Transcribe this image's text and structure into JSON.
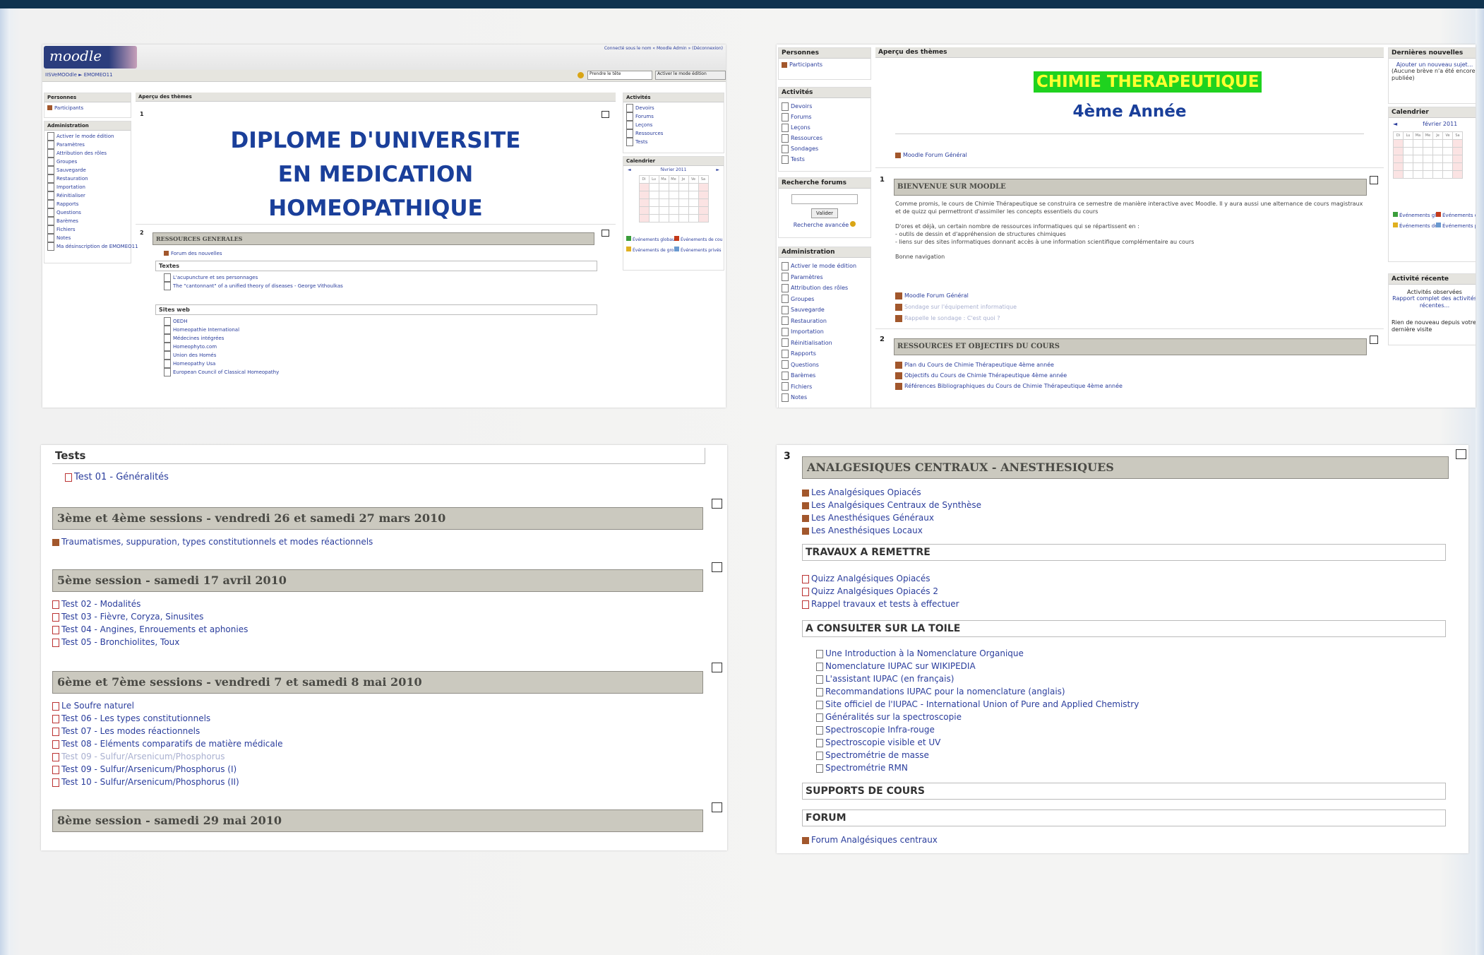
{
  "p1": {
    "logo": "moodle",
    "breadcrumb": "IISVeMOOdle ► EMOMEO11",
    "top_links": "Connecté sous le nom « Moodle Admin » (Déconnexion)",
    "jump_select": "Prendre le tête",
    "edit_button": "Activer le mode édition",
    "left_blocks": {
      "people_title": "Personnes",
      "participants": "Participants",
      "admin_title": "Administration",
      "admin_items": [
        "Activer le mode édition",
        "Paramètres",
        "Attribution des rôles",
        "Groupes",
        "Sauvegarde",
        "Restauration",
        "Importation",
        "Réinitialiser",
        "Rapports",
        "Questions",
        "Barèmes",
        "Fichiers",
        "Notes",
        "Ma désinscription de EMOMEO11"
      ]
    },
    "main": {
      "header": "Aperçu des thèmes",
      "sec1_num": "1",
      "title_line1": "DIPLOME D'UNIVERSITE",
      "title_line2": "EN MEDICATION",
      "title_line3": "HOMEOPATHIQUE",
      "sec2_num": "2",
      "res_title": "RESSOURCES GENERALES",
      "forum": "Forum des nouvelles",
      "textes_title": "Textes",
      "textes": [
        "L'acupuncture et ses personnages",
        "The \"cantonnant\" of a unified theory of diseases - George Vithoulkas"
      ],
      "sites_title": "Sites web",
      "sites": [
        "OEDH",
        "Homeopathie International",
        "Médecines intégrées",
        "Homeophyto.com",
        "Union des Homés",
        "Homeopathy Usa",
        "European Council of Classical Homeopathy"
      ]
    },
    "right_blocks": {
      "activities_title": "Activités",
      "activities": [
        "Devoirs",
        "Forums",
        "Leçons",
        "Ressources",
        "Tests"
      ],
      "calendar_title": "Calendrier",
      "calendar_month": "février 2011",
      "calendar_days": [
        "Di",
        "Lu",
        "Ma",
        "Me",
        "Je",
        "Ve",
        "Sa"
      ],
      "legend": [
        "Événements globaux",
        "Événements de cours",
        "Événements de groupe",
        "Événements privés"
      ]
    }
  },
  "p2": {
    "left_blocks": {
      "people_title": "Personnes",
      "participants": "Participants",
      "activities_title": "Activités",
      "activities": [
        "Devoirs",
        "Forums",
        "Leçons",
        "Ressources",
        "Sondages",
        "Tests"
      ],
      "search_title": "Recherche forums",
      "search_button": "Valider",
      "search_adv": "Recherche avancée",
      "admin_title": "Administration",
      "admin_items": [
        "Activer le mode édition",
        "Paramètres",
        "Attribution des rôles",
        "Groupes",
        "Sauvegarde",
        "Restauration",
        "Importation",
        "Réinitialisation",
        "Rapports",
        "Questions",
        "Barèmes",
        "Fichiers",
        "Notes"
      ]
    },
    "main": {
      "header": "Aperçu des thèmes",
      "title_green": "CHIMIE THERAPEUTIQUE",
      "subtitle": "4ème Année",
      "forum_general": "Moodle Forum Général",
      "sec1_num": "1",
      "welcome_title": "BIENVENUE SUR MOODLE",
      "welcome_p1": "Comme promis, le cours de Chimie Thérapeutique se construira ce semestre de manière interactive avec Moodle. Il y aura aussi une alternance de cours magistraux et de quizz qui permettront d'assimiler les concepts essentiels du cours",
      "welcome_p2a": "D'ores et déjà, un certain nombre de ressources informatiques qui se répartissent en :",
      "welcome_p2b": "- outils de dessin et d'appréhension de structures chimiques",
      "welcome_p2c": "- liens sur des sites informatiques donnant accès à une information scientifique complémentaire au cours",
      "welcome_p3": "Bonne navigation",
      "welcome_links": [
        "Moodle Forum Général",
        "Sondage sur l'équipement informatique",
        "Rappelle le sondage : C'est quoi ?"
      ],
      "sec2_num": "2",
      "obj_title": "RESSOURCES ET OBJECTIFS DU COURS",
      "obj_links": [
        "Plan du Cours de Chimie Thérapeutique 4ème année",
        "Objectifs du Cours de Chimie Thérapeutique 4ème année",
        "Références Bibliographiques du Cours de Chimie Thérapeutique 4ème année"
      ]
    },
    "right_blocks": {
      "news_title": "Dernières nouvelles",
      "news_add": "Ajouter un nouveau sujet...",
      "news_none": "(Aucune brève n'a été encore publiée)",
      "calendar_title": "Calendrier",
      "calendar_month": "février 2011",
      "legend": [
        "Événements globaux",
        "Événements de cours",
        "Événements de groupe",
        "Événements privés"
      ],
      "recent_title": "Activité récente",
      "recent_text": "Activités observées",
      "recent_link": "Rapport complet des activités récentes...",
      "recent_none": "Rien de nouveau depuis votre dernière visite"
    }
  },
  "p3": {
    "tests_title": "Tests",
    "test01": "Test 01 - Généralités",
    "s1_title": "3ème et 4ème sessions - vendredi 26 et samedi 27 mars 2010",
    "s1_items": [
      "Traumatismes, suppuration, types constitutionnels et modes réactionnels"
    ],
    "s2_title": "5ème session - samedi 17 avril 2010",
    "s2_items": [
      "Test 02 - Modalités",
      "Test 03 - Fièvre, Coryza, Sinusites",
      "Test 04 - Angines, Enrouements et aphonies",
      "Test 05 - Bronchiolites, Toux"
    ],
    "s3_title": "6ème et 7ème sessions - vendredi 7 et samedi 8 mai 2010",
    "s3_items": [
      "Le Soufre naturel",
      "Test 06 - Les types constitutionnels",
      "Test 07 - Les modes réactionnels",
      "Test 08 - Eléments comparatifs de matière médicale",
      "Test 09 - Sulfur/Arsenicum/Phosphorus",
      "Test 09 - Sulfur/Arsenicum/Phosphorus (I)",
      "Test 10 - Sulfur/Arsenicum/Phosphorus (II)"
    ],
    "s4_title": "8ème session - samedi 29 mai 2010"
  },
  "p4": {
    "sec_num": "3",
    "title": "ANALGESIQUES CENTRAUX - ANESTHESIQUES",
    "items": [
      "Les Analgésiques Opiacés",
      "Les Analgésiques Centraux de Synthèse",
      "Les Anesthésiques Généraux",
      "Les Anesthésiques Locaux"
    ],
    "travaux_title": "TRAVAUX A REMETTRE",
    "travaux": [
      "Quizz Analgésiques Opiacés",
      "Quizz Analgésiques Opiacés 2",
      "Rappel travaux et tests à effectuer"
    ],
    "toile_title": "A CONSULTER SUR LA TOILE",
    "toile": [
      "Une Introduction à la Nomenclature Organique",
      "Nomenclature IUPAC sur WIKIPEDIA",
      "L'assistant IUPAC (en français)",
      "Recommandations IUPAC pour la nomenclature (anglais)",
      "Site officiel de l'IUPAC - International Union of Pure and Applied Chemistry",
      "Généralités sur la spectroscopie",
      "Spectroscopie Infra-rouge",
      "Spectroscopie visible et UV",
      "Spectrométrie de masse",
      "Spectrométrie RMN"
    ],
    "supports_title": "SUPPORTS DE COURS",
    "forum_title": "FORUM",
    "forum_link": "Forum Analgésiques centraux"
  }
}
